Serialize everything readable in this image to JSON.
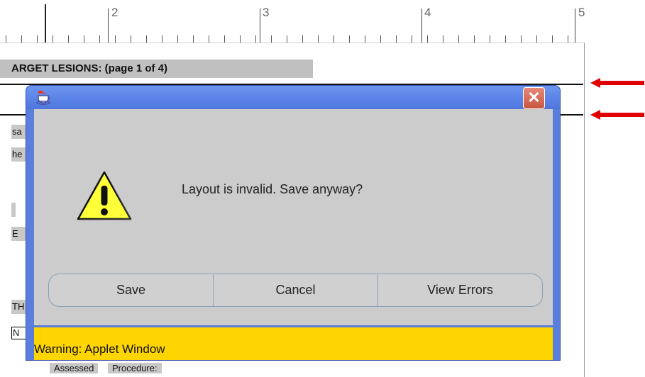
{
  "ruler": {
    "labels": [
      "2",
      "3",
      "4",
      "5"
    ]
  },
  "form": {
    "heading": "ARGET LESIONS:  (page 1 of 4)",
    "fragments": [
      "sa",
      "he",
      "",
      "E",
      "TH",
      "N"
    ],
    "bottom_labels": [
      "Assessed",
      "Procedure:"
    ]
  },
  "annotations": {
    "arrow_color": "#e00000"
  },
  "dialog": {
    "title": "",
    "icon": "java-cup-icon",
    "close_icon": "close-icon",
    "close_label": "✕",
    "message": "Layout is invalid. Save anyway?",
    "message_icon": "warning-triangle-icon",
    "buttons": {
      "save": "Save",
      "cancel": "Cancel",
      "view_errors": "View Errors"
    },
    "warning": "Warning: Applet Window",
    "colors": {
      "title_bar": "#5a82e6",
      "close": "#c9563f",
      "warning_bar": "#ffd500",
      "body": "#cccccc"
    }
  }
}
